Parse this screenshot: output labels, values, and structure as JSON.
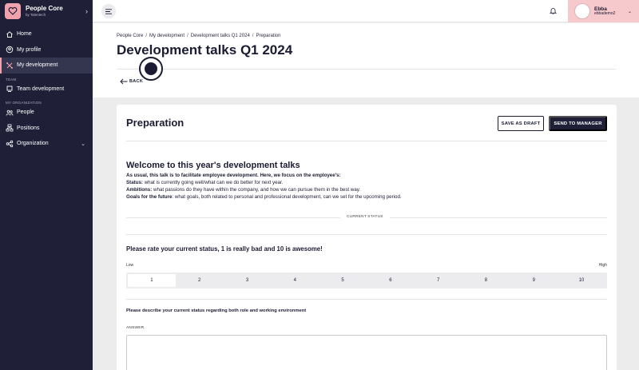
{
  "brand": {
    "name": "People Core",
    "sub": "by Talentech",
    "logo_icon": "heart-icon"
  },
  "sidebar": {
    "items": [
      {
        "label": "Home",
        "icon": "home-icon"
      },
      {
        "label": "My profile",
        "icon": "profile-icon"
      },
      {
        "label": "My development",
        "icon": "development-icon",
        "active": true
      }
    ],
    "team_section": "TEAM",
    "team_items": [
      {
        "label": "Team development",
        "icon": "team-icon"
      }
    ],
    "org_section": "MY ORGANIZATION",
    "org_items": [
      {
        "label": "People",
        "icon": "people-icon"
      },
      {
        "label": "Positions",
        "icon": "positions-icon"
      },
      {
        "label": "Organization",
        "icon": "organization-icon"
      }
    ]
  },
  "user": {
    "name": "Ebba",
    "handle": "ebbademo2"
  },
  "breadcrumb": [
    "People Core",
    "My development",
    "Development talks Q1 2024",
    "Preparation"
  ],
  "page_title": "Development talks Q1 2024",
  "back_label": "BACK",
  "card": {
    "title": "Preparation",
    "save_draft": "SAVE AS DRAFT",
    "send_manager": "SEND TO MANAGER",
    "welcome_title": "Welcome to this year's development talks",
    "intro_line": "As usual, this talk is to facilitate employee development. Here, we focus on the employee's:",
    "status_label": "Status:",
    "status_text": " what is currently going well/what can we do better for next year.",
    "ambitions_label": "Ambitions:",
    "ambitions_text": " what passions do they have within the company, and how we can pursue them in the best way.",
    "goals_label": "Goals for the future",
    "goals_text": ": what goals, both related to personal and professional development, can we set for the upcoming period.",
    "section_current": "CURRENT STATUS",
    "rating_question": "Please rate your current status, 1 is really bad and 10 is awesome!",
    "scale_low": "Low",
    "scale_high": "High",
    "scale_options": [
      "1",
      "2",
      "3",
      "4",
      "5",
      "6",
      "7",
      "8",
      "9",
      "10"
    ],
    "scale_selected": "1",
    "describe_question": "Please describe your current status regarding both role and working environment",
    "answer_label": "ANSWER",
    "answer_value": ""
  },
  "colors": {
    "sidebar": "#1f2038",
    "accent": "#f0a3ad",
    "user_pill": "#f6c9cc"
  }
}
